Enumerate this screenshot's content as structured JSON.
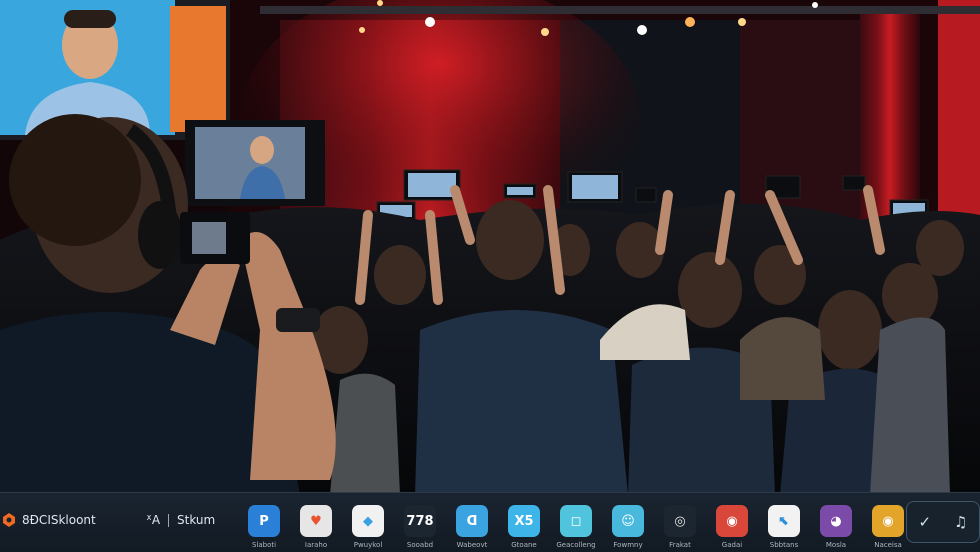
{
  "taskbar": {
    "brand_label": "8ĐCISkloont",
    "brand2_logo": "ᕽA",
    "brand2_label": "Stkum",
    "apps": [
      {
        "icon": "panel-icon",
        "glyph": "P",
        "label": "Slaboti",
        "color": "#2a7fd6"
      },
      {
        "icon": "heart-icon",
        "glyph": "♥",
        "label": "Iaraho",
        "color": "#e6e6e6",
        "fg": "#e8532f"
      },
      {
        "icon": "palette-icon",
        "glyph": "◆",
        "label": "Pwuykol",
        "color": "#f1f1f1",
        "fg": "#3aa0e6"
      },
      {
        "icon": "number-icon",
        "glyph": "778",
        "label": "Sooabd",
        "color": "#1c2630",
        "fg": "#ffffff"
      },
      {
        "icon": "chat-icon",
        "glyph": "ᗡ",
        "label": "Wabeovt",
        "color": "#3aa3e0"
      },
      {
        "icon": "xbox-icon",
        "glyph": "X5",
        "label": "Gtoane",
        "color": "#3db5e8"
      },
      {
        "icon": "camera-icon",
        "glyph": "◻",
        "label": "Geacolleng",
        "color": "#4fc4dc"
      },
      {
        "icon": "smile-icon",
        "glyph": "☺",
        "label": "Fowmny",
        "color": "#48b8dd"
      },
      {
        "icon": "pin-icon",
        "glyph": "◎",
        "label": "Frakat",
        "color": "#1c2630",
        "fg": "#e8e8e8"
      },
      {
        "icon": "chrome-icon",
        "glyph": "◉",
        "label": "Gadai",
        "color": "#d9473a"
      },
      {
        "icon": "link-icon",
        "glyph": "⬉",
        "label": "Sbbtans",
        "color": "#f2f2f2",
        "fg": "#2f8fd8"
      },
      {
        "icon": "lens-icon",
        "glyph": "◕",
        "label": "Mosla",
        "color": "#7c4aa8"
      },
      {
        "icon": "chrome-color-icon",
        "glyph": "◉",
        "label": "Naceisa",
        "color": "#e2a52a"
      }
    ],
    "tray_icons": [
      "check-icon",
      "music-icon"
    ],
    "tray_glyphs": [
      "✓",
      "♫"
    ]
  }
}
